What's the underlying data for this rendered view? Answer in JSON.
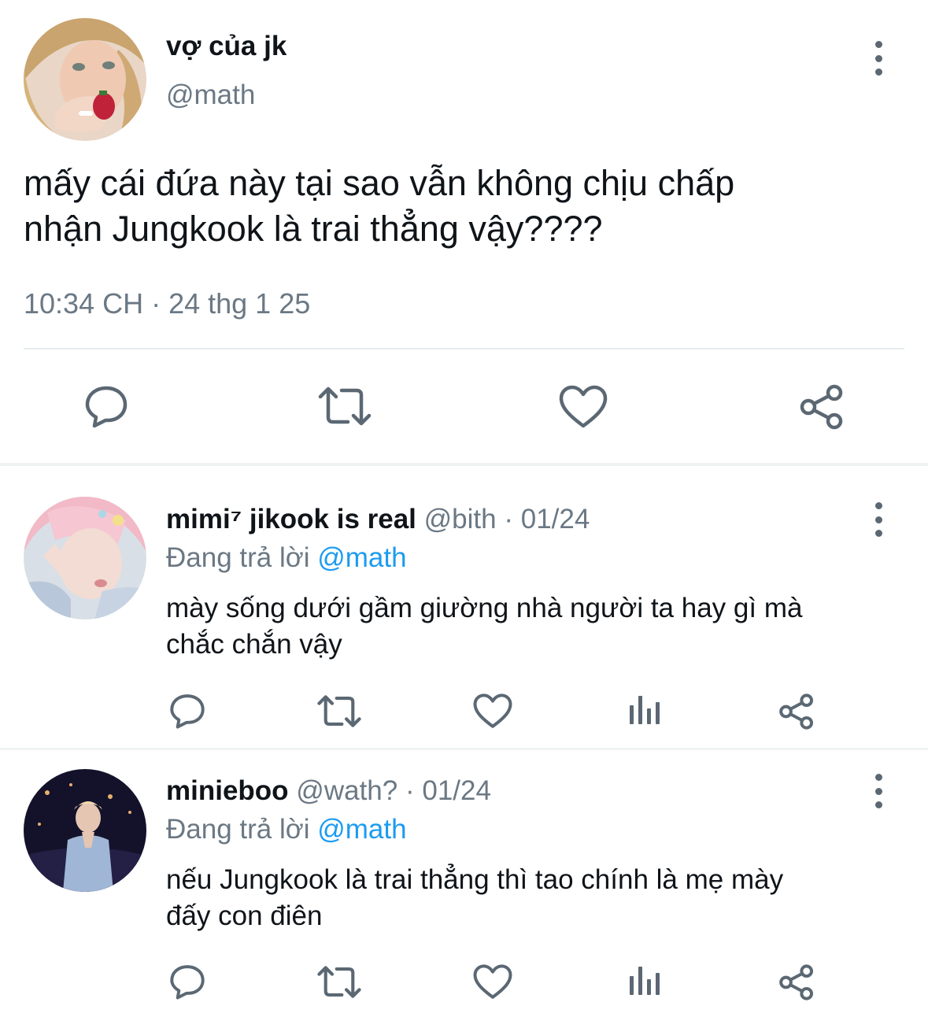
{
  "main_tweet": {
    "display_name": "vợ của jk",
    "handle": "@math",
    "text_lines": [
      "mấy cái đứa này tại sao vẫn không chịu chấp",
      "nhận Jungkook là trai thẳng vậy????"
    ],
    "timestamp": "10:34 CH · 24 thg 1 25",
    "actions": [
      "reply-icon",
      "retweet-icon",
      "like-icon",
      "share-icon"
    ]
  },
  "replies": [
    {
      "display_name": "mimi⁷ jikook is real",
      "handle": "@bith",
      "date": "· 01/24",
      "replying_prefix": "Đang trả lời",
      "replying_to": "@math",
      "text_lines": [
        "mày sống dưới gầm giường nhà người ta hay gì mà",
        "chắc chắn vậy"
      ],
      "actions": [
        "reply-icon",
        "retweet-icon",
        "like-icon",
        "views-icon",
        "share-icon"
      ]
    },
    {
      "display_name": "minieboo",
      "handle": "@wath?",
      "date": "· 01/24",
      "replying_prefix": "Đang trả lời",
      "replying_to": "@math",
      "text_lines": [
        "nếu Jungkook là trai thẳng thì tao chính là mẹ mày",
        "đấy con điên"
      ],
      "actions": [
        "reply-icon",
        "retweet-icon",
        "like-icon",
        "views-icon",
        "share-icon"
      ]
    }
  ],
  "colors": {
    "icon": "#5b6873",
    "link": "#1d9bf0",
    "muted": "#6b7884",
    "divider": "#eff3f4"
  }
}
